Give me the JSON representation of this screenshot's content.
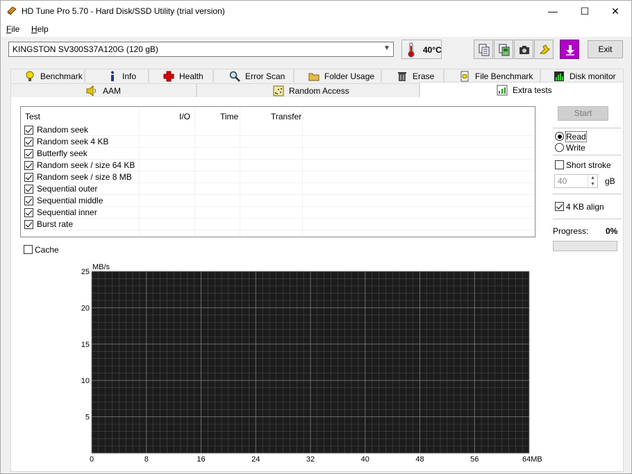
{
  "window": {
    "title": "HD Tune Pro 5.70 - Hard Disk/SSD Utility (trial version)",
    "controls": {
      "minimize": "—",
      "maximize": "☐",
      "close": "✕"
    }
  },
  "menu": [
    {
      "label": "File",
      "underline": "F",
      "rest": "ile"
    },
    {
      "label": "Help",
      "underline": "H",
      "rest": "elp"
    }
  ],
  "drive": {
    "selected": "KINGSTON SV300S37A120G (120 gB)",
    "temperature": "40°C"
  },
  "toolbar": {
    "icons": [
      "copy-text-icon",
      "copy-screenshot-icon",
      "camera-icon",
      "settings-icon",
      "download-icon"
    ],
    "exit_label": "Exit"
  },
  "tabs_row1": [
    {
      "label": "Benchmark",
      "icon": "lightbulb-icon"
    },
    {
      "label": "Info",
      "icon": "info-icon"
    },
    {
      "label": "Health",
      "icon": "health-cross-icon"
    },
    {
      "label": "Error Scan",
      "icon": "magnifier-icon"
    },
    {
      "label": "Folder Usage",
      "icon": "folder-icon"
    },
    {
      "label": "Erase",
      "icon": "trash-icon"
    },
    {
      "label": "File Benchmark",
      "icon": "file-benchmark-icon"
    },
    {
      "label": "Disk monitor",
      "icon": "disk-monitor-icon"
    }
  ],
  "tabs_row2": [
    {
      "label": "AAM",
      "icon": "speaker-icon"
    },
    {
      "label": "Random Access",
      "icon": "random-access-icon"
    },
    {
      "label": "Extra tests",
      "icon": "extra-tests-icon",
      "active": true
    }
  ],
  "table": {
    "columns": [
      "Test",
      "I/O",
      "Time",
      "Transfer"
    ],
    "rows": [
      {
        "label": "Random seek",
        "checked": true
      },
      {
        "label": "Random seek 4 KB",
        "checked": true
      },
      {
        "label": "Butterfly seek",
        "checked": true
      },
      {
        "label": "Random seek / size 64 KB",
        "checked": true
      },
      {
        "label": "Random seek / size 8 MB",
        "checked": true
      },
      {
        "label": "Sequential outer",
        "checked": true
      },
      {
        "label": "Sequential middle",
        "checked": true
      },
      {
        "label": "Sequential inner",
        "checked": true
      },
      {
        "label": "Burst rate",
        "checked": true
      }
    ]
  },
  "cache": {
    "label": "Cache",
    "checked": false
  },
  "controls": {
    "start_label": "Start",
    "read_label": "Read",
    "write_label": "Write",
    "mode": "read",
    "short_stroke_label": "Short stroke",
    "short_stroke_checked": false,
    "short_stroke_value": "40",
    "short_stroke_unit": "gB",
    "align_label": "4 KB align",
    "align_checked": true,
    "progress_label": "Progress:",
    "progress_value": "0%",
    "progress_fraction": 0
  },
  "colors": {
    "chart_bg": "#1c1c1c",
    "grid": "#7f7f7f",
    "progress": "#06b025"
  },
  "chart_data": {
    "type": "line",
    "ylabel": "MB/s",
    "xlabel": "MB",
    "ylim": [
      0,
      25
    ],
    "xlim": [
      0,
      64
    ],
    "yticks": [
      "25",
      "20",
      "15",
      "10",
      "5"
    ],
    "xticks": [
      "0",
      "8",
      "16",
      "24",
      "32",
      "40",
      "48",
      "56",
      "64MB"
    ],
    "grid": true,
    "series": []
  }
}
